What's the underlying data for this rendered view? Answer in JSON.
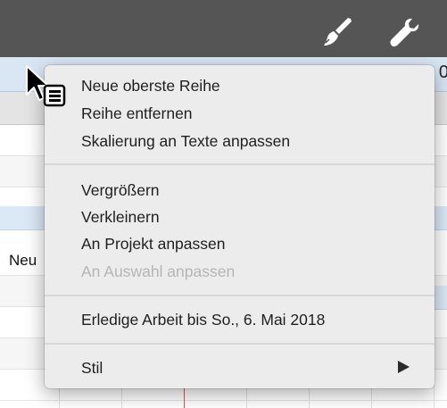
{
  "toolbar": {
    "icons": [
      "paintbrush-icon",
      "wrench-icon"
    ]
  },
  "grid": {
    "header_digit": "0",
    "row_label": "Neu"
  },
  "context_menu": {
    "items": [
      {
        "label": "Neue oberste Reihe",
        "enabled": true
      },
      {
        "label": "Reihe entfernen",
        "enabled": true
      },
      {
        "label": "Skalierung an Texte anpassen",
        "enabled": true
      },
      {
        "label": "Vergrößern",
        "enabled": true
      },
      {
        "label": "Verkleinern",
        "enabled": true
      },
      {
        "label": "An Projekt anpassen",
        "enabled": true
      },
      {
        "label": "An Auswahl anpassen",
        "enabled": false
      },
      {
        "label": "Erledige Arbeit bis So., 6. Mai 2018",
        "enabled": true
      },
      {
        "label": "Stil",
        "enabled": true,
        "submenu": true
      }
    ]
  },
  "colors": {
    "toolbar_bg": "#555555",
    "menu_bg": "#ececec",
    "disabled_text": "#b5b5b5",
    "header_blue": "#d9e6f4"
  }
}
